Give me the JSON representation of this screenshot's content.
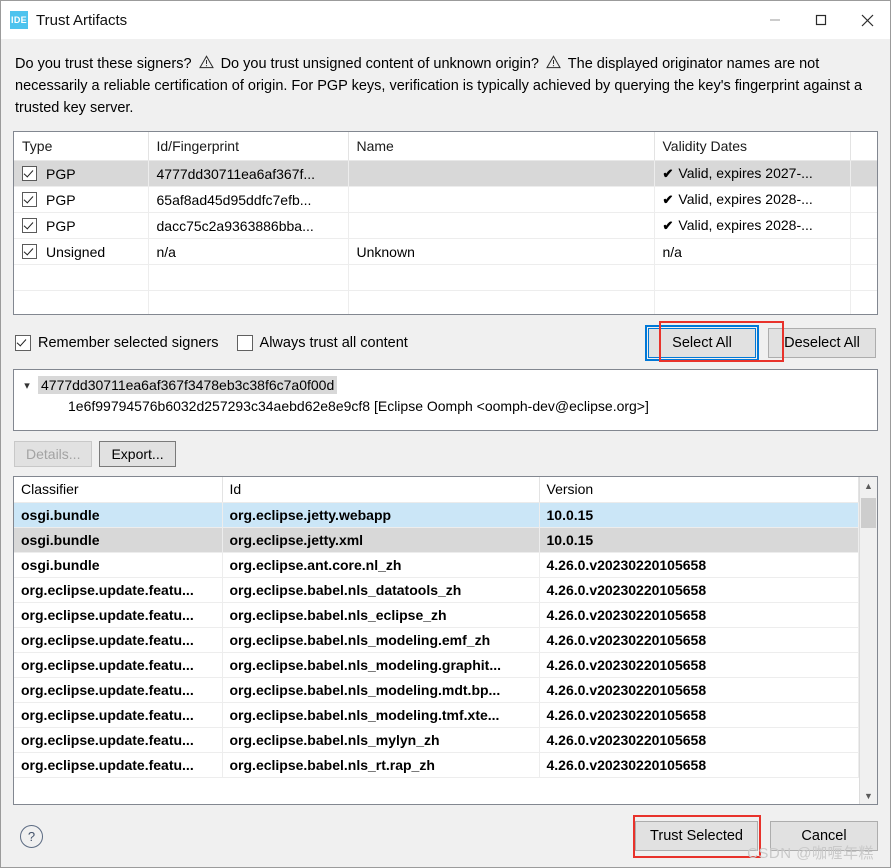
{
  "window": {
    "title": "Trust Artifacts",
    "icon_label": "IDE",
    "minimize_icon": "minimize-icon",
    "maximize_icon": "maximize-icon",
    "close_icon": "close-icon"
  },
  "prompt": {
    "part1": "Do you trust these signers?",
    "part2": "Do you trust unsigned content of unknown origin?",
    "part3": "The displayed originator names are not necessarily a reliable certification of origin.  For PGP keys, verification is typically achieved by querying the key's fingerprint against a trusted key server."
  },
  "signers_table": {
    "columns": [
      "Type",
      "Id/Fingerprint",
      "Name",
      "Validity Dates",
      ""
    ],
    "rows": [
      {
        "checked": true,
        "selected": true,
        "type": "PGP",
        "fingerprint": "4777dd30711ea6af367f...",
        "name": "",
        "valid_icon": "check-icon",
        "validity": "Valid, expires 2027-..."
      },
      {
        "checked": true,
        "selected": false,
        "type": "PGP",
        "fingerprint": "65af8ad45d95ddfc7efb...",
        "name": "",
        "valid_icon": "check-icon",
        "validity": "Valid, expires 2028-..."
      },
      {
        "checked": true,
        "selected": false,
        "type": "PGP",
        "fingerprint": "dacc75c2a9363886bba...",
        "name": "",
        "valid_icon": "check-icon",
        "validity": "Valid, expires 2028-..."
      },
      {
        "checked": true,
        "selected": false,
        "type": "Unsigned",
        "fingerprint": "n/a",
        "name": "Unknown",
        "valid_icon": "",
        "validity": "n/a"
      }
    ]
  },
  "options": {
    "remember_label": "Remember selected signers",
    "remember_checked": true,
    "always_trust_label": "Always trust all content",
    "always_trust_checked": false,
    "select_all_label": "Select All",
    "deselect_all_label": "Deselect All"
  },
  "fingerprint_panel": {
    "expander_icon": "chevron-down-icon",
    "key_id": "4777dd30711ea6af367f3478eb3c38f6c7a0f00d",
    "detail": "1e6f99794576b6032d257293c34aebd62e8e9cf8 [Eclipse Oomph <oomph-dev@eclipse.org>]"
  },
  "mini_buttons": {
    "details_label": "Details...",
    "details_disabled": true,
    "export_label": "Export...",
    "export_disabled": false
  },
  "artifacts_table": {
    "columns": [
      "Classifier",
      "Id",
      "Version"
    ],
    "rows": [
      {
        "classifier": "osgi.bundle",
        "id": "org.eclipse.jetty.webapp",
        "version": "10.0.15",
        "state": "blue"
      },
      {
        "classifier": "osgi.bundle",
        "id": "org.eclipse.jetty.xml",
        "version": "10.0.15",
        "state": "grey"
      },
      {
        "classifier": "osgi.bundle",
        "id": "org.eclipse.ant.core.nl_zh",
        "version": "4.26.0.v20230220105658",
        "state": ""
      },
      {
        "classifier": "org.eclipse.update.featu...",
        "id": "org.eclipse.babel.nls_datatools_zh",
        "version": "4.26.0.v20230220105658",
        "state": ""
      },
      {
        "classifier": "org.eclipse.update.featu...",
        "id": "org.eclipse.babel.nls_eclipse_zh",
        "version": "4.26.0.v20230220105658",
        "state": ""
      },
      {
        "classifier": "org.eclipse.update.featu...",
        "id": "org.eclipse.babel.nls_modeling.emf_zh",
        "version": "4.26.0.v20230220105658",
        "state": ""
      },
      {
        "classifier": "org.eclipse.update.featu...",
        "id": "org.eclipse.babel.nls_modeling.graphit...",
        "version": "4.26.0.v20230220105658",
        "state": ""
      },
      {
        "classifier": "org.eclipse.update.featu...",
        "id": "org.eclipse.babel.nls_modeling.mdt.bp...",
        "version": "4.26.0.v20230220105658",
        "state": ""
      },
      {
        "classifier": "org.eclipse.update.featu...",
        "id": "org.eclipse.babel.nls_modeling.tmf.xte...",
        "version": "4.26.0.v20230220105658",
        "state": ""
      },
      {
        "classifier": "org.eclipse.update.featu...",
        "id": "org.eclipse.babel.nls_mylyn_zh",
        "version": "4.26.0.v20230220105658",
        "state": ""
      },
      {
        "classifier": "org.eclipse.update.featu...",
        "id": "org.eclipse.babel.nls_rt.rap_zh",
        "version": "4.26.0.v20230220105658",
        "state": ""
      }
    ],
    "scroll_up_icon": "chevron-up-icon",
    "scroll_down_icon": "chevron-down-icon"
  },
  "footer": {
    "help_icon": "help-icon",
    "help_label": "?",
    "trust_selected_label": "Trust Selected",
    "cancel_label": "Cancel"
  },
  "watermark": "CSDN @咖喱年糕",
  "colors": {
    "selection_blue": "#cbe6f7",
    "focus_blue": "#0078d7",
    "annotation_red": "#e8322b",
    "row_grey": "#d8d8d8",
    "icon_blue": "#4ec3ee"
  }
}
